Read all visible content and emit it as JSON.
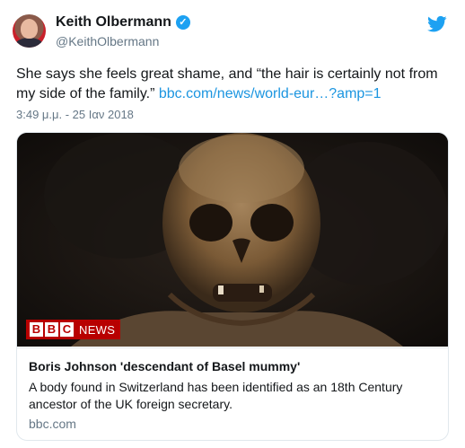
{
  "author": {
    "name": "Keith Olbermann",
    "handle": "@KeithOlbermann",
    "verified_icon": "verified-badge-icon"
  },
  "tweet": {
    "text": "She says she feels great shame, and “the hair is certainly not from my side of the family.”",
    "link": "bbc.com/news/world-eur…?amp=1",
    "timestamp": "3:49 μ.μ. - 25 Ιαν 2018"
  },
  "card": {
    "image_logo_text": "BBC NEWS",
    "title": "Boris Johnson 'descendant of Basel mummy'",
    "description": "A body found in Switzerland has been identified as an 18th Century ancestor of the UK foreign secretary.",
    "domain": "bbc.com"
  },
  "colors": {
    "link": "#1b95e0",
    "twitter_blue": "#1da1f2",
    "muted": "#657786",
    "bbc_red": "#b80000"
  }
}
